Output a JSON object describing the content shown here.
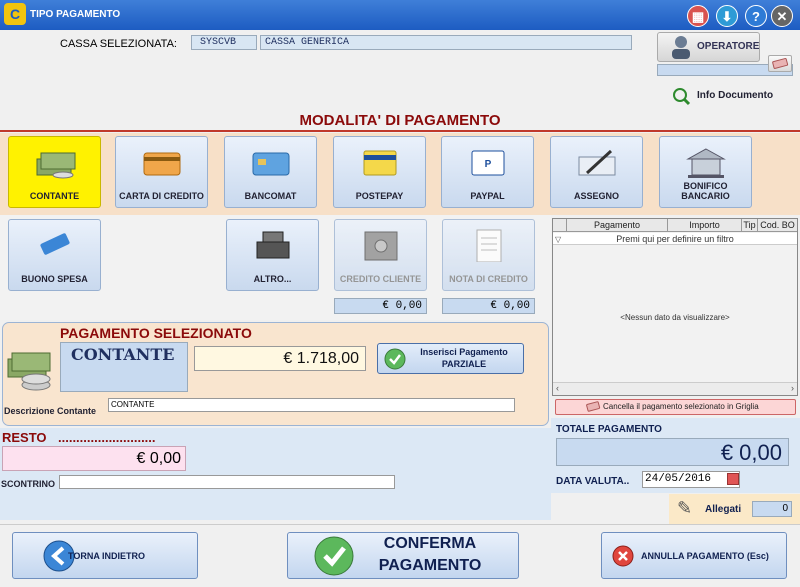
{
  "window": {
    "title": "TIPO PAGAMENTO",
    "logo": "C"
  },
  "titlebar_buttons": [
    {
      "name": "calculator-icon",
      "glyph": "▦",
      "color": "#d9534f"
    },
    {
      "name": "download-icon",
      "glyph": "⬇",
      "color": "#2e9bd6"
    },
    {
      "name": "help-icon",
      "glyph": "?",
      "color": "#2e7bd6"
    },
    {
      "name": "close-icon",
      "glyph": "✕",
      "color": "#666666"
    }
  ],
  "cassa": {
    "label": "CASSA SELEZIONATA:",
    "code": "SYSCVB",
    "name": "CASSA GENERICA"
  },
  "operatore": {
    "label": "OPERATORE"
  },
  "info_documento": {
    "label": "Info Documento"
  },
  "modalita": {
    "title": "MODALITA' DI PAGAMENTO"
  },
  "payment_methods": [
    {
      "label": "CONTANTE",
      "icon": "cash-icon",
      "selected": true
    },
    {
      "label": "CARTA DI CREDITO",
      "icon": "credit-card-icon"
    },
    {
      "label": "BANCOMAT",
      "icon": "debit-card-icon"
    },
    {
      "label": "POSTEPAY",
      "icon": "postepay-icon"
    },
    {
      "label": "PAYPAL",
      "icon": "paypal-icon"
    },
    {
      "label": "ASSEGNO",
      "icon": "cheque-icon"
    },
    {
      "label": "BONIFICO BANCARIO",
      "icon": "bank-icon"
    }
  ],
  "payment_methods_2": [
    {
      "label": "BUONO SPESA",
      "icon": "voucher-icon"
    },
    {
      "label": "ALTRO...",
      "icon": "cash-register-icon"
    },
    {
      "label": "CREDITO CLIENTE",
      "icon": "safe-icon",
      "disabled": true,
      "value": "€ 0,00"
    },
    {
      "label": "NOTA DI CREDITO",
      "icon": "document-icon",
      "disabled": true,
      "value": "€ 0,00"
    }
  ],
  "selected_payment": {
    "title": "PAGAMENTO SELEZIONATO",
    "type": "CONTANTE",
    "amount": "€ 1.718,00",
    "partial_button": "Inserisci Pagamento PARZIALE",
    "description_label": "Descrizione Contante",
    "description_value": "CONTANTE"
  },
  "resto": {
    "label": "RESTO",
    "dots": "...........................",
    "value": "€ 0,00"
  },
  "scontrino": {
    "label": "SCONTRINO",
    "value": ""
  },
  "grid": {
    "columns": [
      "Pagamento",
      "Importo",
      "Tip",
      "Cod. BO"
    ],
    "filter_text": "Premi qui per definire un filtro",
    "empty_text": "<Nessun dato da visualizzare>",
    "cancel_button": "Cancella il pagamento selezionato in Griglia"
  },
  "totale": {
    "label": "TOTALE PAGAMENTO",
    "value": "€ 0,00"
  },
  "data_valuta": {
    "label": "DATA VALUTA..",
    "value": "24/05/2016"
  },
  "allegati": {
    "label": "Allegati",
    "count": "0"
  },
  "bottom": {
    "back": "TORNA INDIETRO",
    "confirm": "CONFERMA PAGAMENTO",
    "cancel": "ANNULLA PAGAMENTO (Esc)"
  }
}
